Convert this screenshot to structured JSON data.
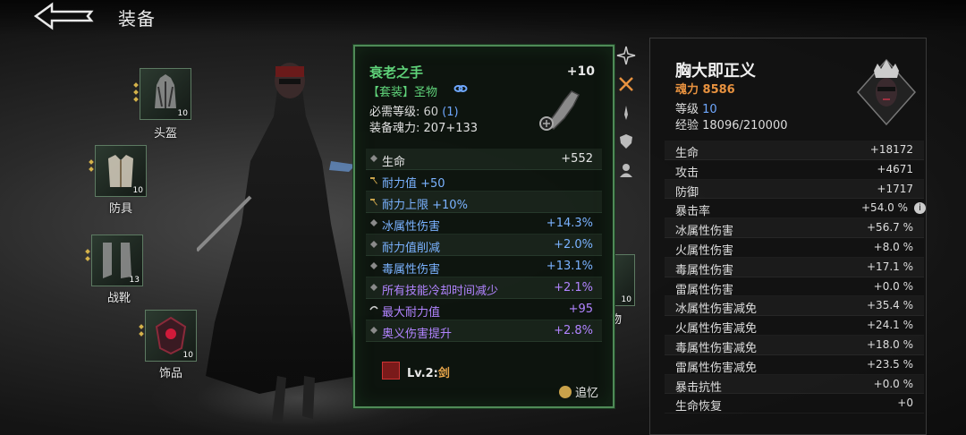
{
  "header": {
    "title": "装备"
  },
  "slots": [
    {
      "label": "头盔",
      "level": "10"
    },
    {
      "label": "防具",
      "level": "10"
    },
    {
      "label": "战靴",
      "level": "13"
    },
    {
      "label": "饰品",
      "level": "10"
    }
  ],
  "partial": {
    "label": "物",
    "level": "10"
  },
  "tooltip": {
    "name": "衰老之手",
    "plus": "+10",
    "set": "【套装】圣物",
    "req_label": "必需等级:",
    "req_value": "60",
    "req_bonus": "(1)",
    "soul_label": "装备魂力:",
    "soul_value": "207+133",
    "rows": [
      {
        "k": "生命",
        "v": "+552",
        "style": "white",
        "icon": "diamond"
      },
      {
        "k": "耐力值 +50",
        "v": "",
        "style": "blue",
        "icon": "hammer"
      },
      {
        "k": "耐力上限 +10%",
        "v": "",
        "style": "blue",
        "icon": "hammer"
      },
      {
        "k": "冰属性伤害",
        "v": "+14.3%",
        "style": "blue",
        "icon": "diamond"
      },
      {
        "k": "耐力值削减",
        "v": "+2.0%",
        "style": "blue",
        "icon": "diamond"
      },
      {
        "k": "毒属性伤害",
        "v": "+13.1%",
        "style": "blue",
        "icon": "diamond"
      },
      {
        "k": "所有技能冷却时间减少",
        "v": "+2.1%",
        "style": "purple",
        "icon": "diamond"
      },
      {
        "k": "最大耐力值",
        "v": "+95",
        "style": "purple",
        "icon": "swirl"
      },
      {
        "k": "奥义伤害提升",
        "v": "+2.8%",
        "style": "purple",
        "icon": "diamond"
      }
    ],
    "skill_prefix": "Lv.2:",
    "skill_name": "剑",
    "recall": "追忆"
  },
  "panel": {
    "name": "胸大即正义",
    "soul": "魂力 8586",
    "level_label": "等级",
    "level_value": "10",
    "exp": "经验 18096/210000",
    "stats": [
      {
        "k": "生命",
        "v": "+18172"
      },
      {
        "k": "攻击",
        "v": "+4671"
      },
      {
        "k": "防御",
        "v": "+1717"
      },
      {
        "k": "暴击率",
        "v": "+54.0 %",
        "info": true
      },
      {
        "k": "冰属性伤害",
        "v": "+56.7 %"
      },
      {
        "k": "火属性伤害",
        "v": "+8.0 %"
      },
      {
        "k": "毒属性伤害",
        "v": "+17.1 %"
      },
      {
        "k": "雷属性伤害",
        "v": "+0.0 %"
      },
      {
        "k": "冰属性伤害减免",
        "v": "+35.4 %"
      },
      {
        "k": "火属性伤害减免",
        "v": "+24.1 %"
      },
      {
        "k": "毒属性伤害减免",
        "v": "+18.0 %"
      },
      {
        "k": "雷属性伤害减免",
        "v": "+23.5 %"
      },
      {
        "k": "暴击抗性",
        "v": "+0.0 %"
      },
      {
        "k": "生命恢复",
        "v": "+0"
      }
    ]
  },
  "colors": {
    "rarity_green": "#5fd279",
    "stat_blue": "#7ab2ff",
    "stat_purple": "#b184ff",
    "soul_orange": "#e8923f",
    "panel_bg": "#121212"
  }
}
